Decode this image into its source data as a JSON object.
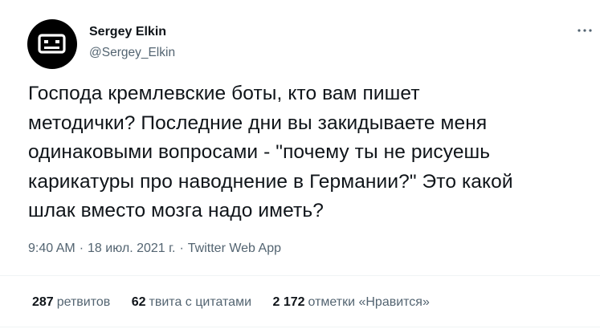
{
  "author": {
    "name": "Sergey Elkin",
    "handle": "@Sergey_Elkin"
  },
  "tweet": {
    "lines": [
      "Господа кремлевские боты, кто вам пишет",
      "методички? Последние дни вы закидываете меня",
      "одинаковыми вопросами - \"почему ты не рисуешь",
      "карикатуры про наводнение в Германии?\" Это какой",
      "шлак вместо мозга надо иметь?"
    ]
  },
  "meta": {
    "time": "9:40 AM",
    "separator": "·",
    "date": "18 июл. 2021 г.",
    "source": "Twitter Web App"
  },
  "stats": {
    "retweets": {
      "count": "287",
      "label": "ретвитов"
    },
    "quotes": {
      "count": "62",
      "label": "твита с цитатами"
    },
    "likes": {
      "count": "2 172",
      "label": "отметки «Нравится»"
    }
  },
  "icons": {
    "more": "more-horizontal-icon",
    "avatar": "robot-face-avatar"
  },
  "colors": {
    "text_primary": "#0f1419",
    "text_secondary": "#536471",
    "divider": "#eff3f4",
    "avatar_bg": "#000000"
  }
}
